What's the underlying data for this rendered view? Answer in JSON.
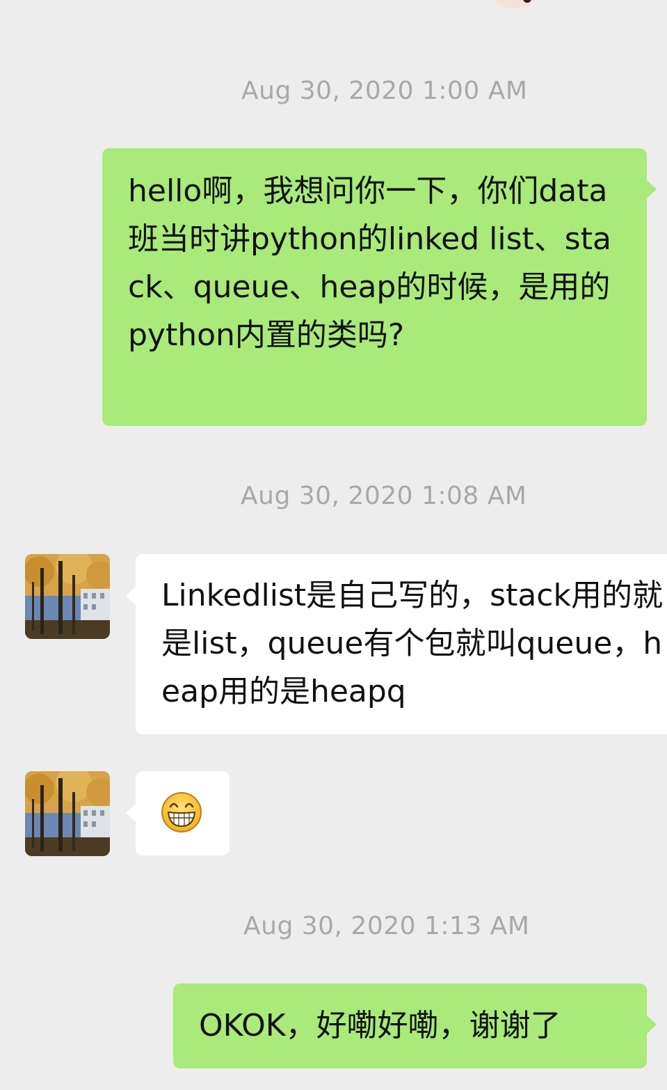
{
  "messages": [
    {
      "type": "timestamp",
      "text": "Aug 30, 2020 1:00 AM"
    },
    {
      "type": "outgoing",
      "text": "hello啊，我想问你一下，你们data班当时讲python的linked list、stack、queue、heap的时候，是用的python内置的类吗?"
    },
    {
      "type": "timestamp",
      "text": "Aug 30, 2020 1:08 AM"
    },
    {
      "type": "incoming",
      "text": "Linkedlist是自己写的，stack用的就是list，queue有个包就叫queue，heap用的是heapq"
    },
    {
      "type": "incoming_emoji",
      "icon": "grin-emoji-icon"
    },
    {
      "type": "timestamp",
      "text": "Aug 30, 2020 1:13 AM"
    },
    {
      "type": "outgoing",
      "text": "OKOK，好嘞好嘞，谢谢了"
    }
  ],
  "colors": {
    "background": "#ededed",
    "outgoing_bubble": "#a9ea7a",
    "incoming_bubble": "#ffffff",
    "timestamp_text": "#a8a8a8"
  }
}
